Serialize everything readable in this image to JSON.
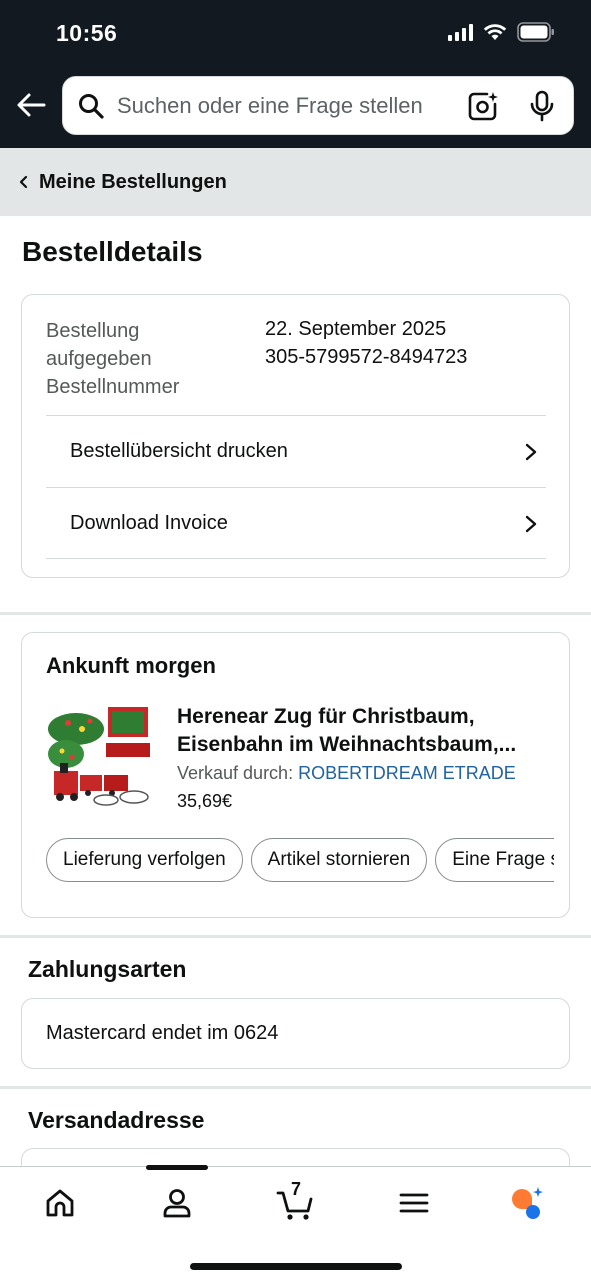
{
  "status_bar": {
    "time": "10:56"
  },
  "search": {
    "placeholder": "Suchen oder eine Frage stellen"
  },
  "breadcrumb": {
    "label": "Meine Bestellungen"
  },
  "page": {
    "title": "Bestelldetails"
  },
  "order": {
    "label_placed": "Bestellung aufgegeben",
    "label_number": "Bestellnummer",
    "date": "22. September 2025",
    "number": "305-5799572-8494723",
    "print_label": "Bestellübersicht drucken",
    "invoice_label": "Download Invoice"
  },
  "shipment": {
    "arrival": "Ankunft morgen",
    "product_title_line1": "Herenear Zug für Christbaum,",
    "product_title_line2": "Eisenbahn im Weihnachtsbaum,...",
    "seller_prefix": "Verkauf durch:",
    "seller_name": "ROBERTDREAM ETRADE",
    "price": "35,69€",
    "buttons": [
      "Lieferung verfolgen",
      "Artikel stornieren",
      "Eine Frage stellen"
    ]
  },
  "payment": {
    "title": "Zahlungsarten",
    "method": "Mastercard  endet im 0624"
  },
  "shipping": {
    "title": "Versandadresse"
  },
  "nav": {
    "cart_count": "7"
  },
  "colors": {
    "header_bg": "#131921",
    "link": "#2162a1",
    "crumb_bg": "#e3e6e6",
    "rufus_orange": "#ff7a32",
    "rufus_blue": "#1a73e8"
  }
}
